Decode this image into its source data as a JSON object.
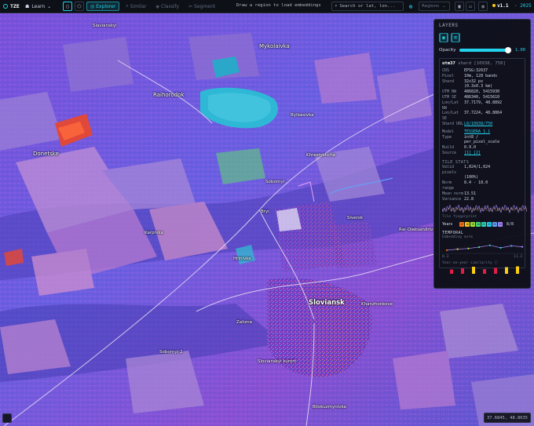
{
  "topbar": {
    "app_name": "TZE",
    "learn_label": "Learn",
    "tabs": [
      {
        "label": "Explorer",
        "icon": "compass-icon",
        "active": true
      },
      {
        "label": "Similar",
        "icon": "search-icon",
        "active": false
      },
      {
        "label": "Classify",
        "icon": "tag-icon",
        "active": false
      },
      {
        "label": "Segment",
        "icon": "scissors-icon",
        "active": false
      }
    ],
    "hint": "Draw a region to load embeddings",
    "search_placeholder": "Search or lat, lon...",
    "regions_label": "Regions",
    "version": "v1.1",
    "year": "2025"
  },
  "map": {
    "places": [
      "Slavianskyi",
      "Mykolaivka",
      "Raihorodok",
      "Bylbasivka",
      "Donetske",
      "Khrestyshche",
      "Sobornyi",
      "Bryi",
      "Siversk",
      "Karpivka",
      "Rai-Oleksandrivka",
      "Hrinivka",
      "Sloviansk",
      "Khanzhonkove",
      "Zalizna",
      "Sobornyi-2",
      "Slovianskyi kurort",
      "Bilokuzmynivka",
      "Malynivka"
    ]
  },
  "layers": {
    "title": "LAYERS",
    "opacity_label": "Opacity",
    "opacity_value": "1.00",
    "opacity_fraction": 1.0
  },
  "shard": {
    "title": "utm37",
    "subtitle": "shard [10938, 750]",
    "rows": [
      {
        "k": "CRS",
        "v": "EPSG:32637"
      },
      {
        "k": "Pixel",
        "v": "10m, 128 bands"
      },
      {
        "k": "Shard",
        "v": "32x32 px"
      },
      {
        "k": "",
        "v": "(0.3x0.3 km)"
      },
      {
        "k": "UTM NW",
        "v": "486820, 5415930"
      },
      {
        "k": "UTM SE",
        "v": "486340, 5415610"
      },
      {
        "k": "Lon/Lat NW",
        "v": "37.7179, 48.8892"
      },
      {
        "k": "Lon/Lat SE",
        "v": "37.7224, 48.8864"
      },
      {
        "k": "Shard URL",
        "v": "L8/10938/750",
        "link": true
      }
    ],
    "model_rows": [
      {
        "k": "Model",
        "v": "TESSERA 1.1",
        "link": true
      },
      {
        "k": "Type",
        "v": "int8 /"
      },
      {
        "k": "",
        "v": "per_pixel_scale"
      },
      {
        "k": "Build",
        "v": "0.9.0"
      },
      {
        "k": "Source",
        "v": "[1] [2]",
        "link": true
      }
    ],
    "stats_title": "TILE STATS",
    "stats_rows": [
      {
        "k": "Valid pixels",
        "v": "1,024/1,024"
      },
      {
        "k": "",
        "v": "(100%)"
      },
      {
        "k": "Norm range",
        "v": "8.4 - 18.0"
      },
      {
        "k": "Mean norm",
        "v": "13.51"
      },
      {
        "k": "Variance",
        "v": "22.8"
      }
    ],
    "fingerprint_label": "Tile fingerprint",
    "years_label": "Years",
    "years_count": "8/8",
    "years": [
      "17",
      "18",
      "19",
      "20",
      "21",
      "22",
      "23",
      "24"
    ],
    "year_colors": [
      "#f97316",
      "#facc15",
      "#a3e635",
      "#4ade80",
      "#2dd4bf",
      "#22d3ee",
      "#60a5fa",
      "#a78bfa"
    ],
    "temporal_title": "TEMPORAL",
    "temporal_sub": "Embedding norm",
    "temporal_min": "0.3",
    "temporal_max": "11.3",
    "similarity_label": "Year-on-year similarity"
  },
  "chart_data": {
    "type": "line",
    "x": [
      "2017",
      "2018",
      "2019",
      "2020",
      "2021",
      "2022",
      "2023",
      "2024"
    ],
    "series": [
      {
        "values": [
          3.1,
          4.0,
          4.6,
          5.8,
          7.4,
          5.2,
          6.9,
          6.1
        ]
      }
    ],
    "ylim": [
      0.3,
      11.3
    ]
  },
  "similarity": [
    0.55,
    0.7,
    0.9,
    0.6,
    0.75,
    0.85,
    0.95
  ],
  "coords": "37.6845, 48.8635",
  "colors": {
    "accent": "#22d3ee",
    "panel_bg": "#0c0f16",
    "map_base": "#7a58d8"
  }
}
